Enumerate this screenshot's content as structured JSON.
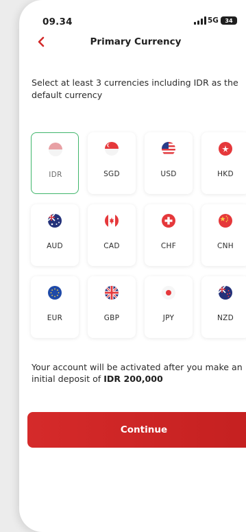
{
  "status_bar": {
    "time": "09.34",
    "network": "5G",
    "battery": "34"
  },
  "header": {
    "title": "Primary Currency"
  },
  "instruction": "Select at least 3 currencies including IDR as the default currency",
  "currencies": [
    {
      "code": "IDR",
      "selected": true,
      "flag_icon": "indonesia-flag-icon"
    },
    {
      "code": "SGD",
      "selected": false,
      "flag_icon": "singapore-flag-icon"
    },
    {
      "code": "USD",
      "selected": false,
      "flag_icon": "usa-flag-icon"
    },
    {
      "code": "HKD",
      "selected": false,
      "flag_icon": "hong-kong-flag-icon"
    },
    {
      "code": "AUD",
      "selected": false,
      "flag_icon": "australia-flag-icon"
    },
    {
      "code": "CAD",
      "selected": false,
      "flag_icon": "canada-flag-icon"
    },
    {
      "code": "CHF",
      "selected": false,
      "flag_icon": "switzerland-flag-icon"
    },
    {
      "code": "CNH",
      "selected": false,
      "flag_icon": "china-flag-icon"
    },
    {
      "code": "EUR",
      "selected": false,
      "flag_icon": "eu-flag-icon"
    },
    {
      "code": "GBP",
      "selected": false,
      "flag_icon": "uk-flag-icon"
    },
    {
      "code": "JPY",
      "selected": false,
      "flag_icon": "japan-flag-icon"
    },
    {
      "code": "NZD",
      "selected": false,
      "flag_icon": "new-zealand-flag-icon"
    }
  ],
  "note": {
    "text": "Your account will be activated after you make an initial deposit of ",
    "amount": "IDR 200,000"
  },
  "continue_label": "Continue",
  "colors": {
    "accent": "#d32a2a",
    "selected_border": "#3fb56a"
  }
}
